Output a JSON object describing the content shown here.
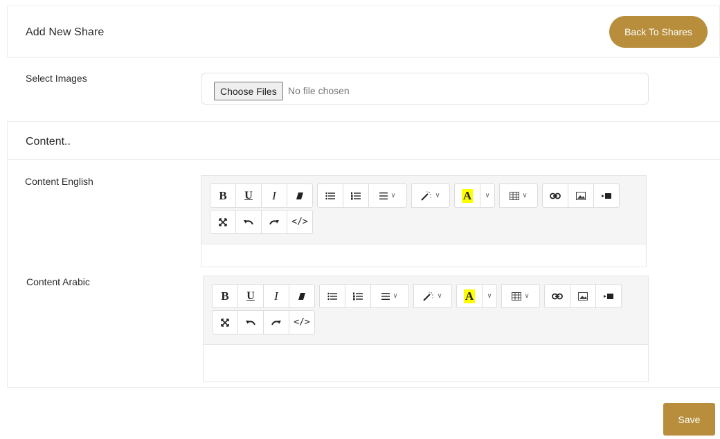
{
  "header": {
    "title": "Add New Share",
    "back_label": "Back To Shares"
  },
  "images": {
    "label": "Select Images",
    "choose_label": "Choose Files",
    "status": "No file chosen"
  },
  "content": {
    "title": "Content..",
    "english_label": "Content English",
    "arabic_label": "Content Arabic"
  },
  "toolbar": {
    "bold": "B",
    "underline": "U",
    "italic": "I",
    "highlight": "A",
    "code": "</>"
  },
  "icons": [
    "eraser-icon",
    "unordered-list-icon",
    "ordered-list-icon",
    "align-icon",
    "magic-wand-icon",
    "text-color-icon",
    "table-icon",
    "link-icon",
    "image-icon",
    "video-icon",
    "fullscreen-icon",
    "undo-icon",
    "redo-icon",
    "code-view-icon"
  ],
  "colors": {
    "accent": "#b88e3c",
    "highlight": "#ffff00"
  },
  "actions": {
    "save_label": "Save"
  }
}
